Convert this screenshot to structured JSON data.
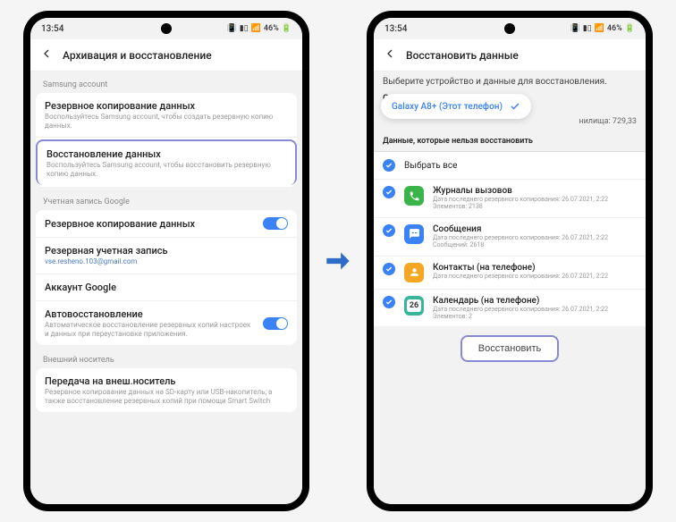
{
  "statusbar": {
    "time": "13:54",
    "battery": "46%"
  },
  "left": {
    "header_title": "Архивация и восстановление",
    "section1_label": "Samsung account",
    "backup_title": "Резервное копирование данных",
    "backup_sub": "Воспользуйтесь Samsung account, чтобы создать резервную копию данных.",
    "restore_title": "Восстановление данных",
    "restore_sub": "Воспользуйтесь Samsung account, чтобы восстановить резервную копию данных.",
    "section2_label": "Учетная запись Google",
    "g_backup_title": "Резервное копирование данных",
    "g_account_title": "Резервная учетная запись",
    "g_account_sub": "vse.resheno.103@gmail.com",
    "g_acct_title2": "Аккаунт Google",
    "autorestore_title": "Автовосстановление",
    "autorestore_sub": "Автоматическое восстановление резервных копий настроек и данных при переустановке приложения.",
    "section3_label": "Внешний носитель",
    "ext_title": "Передача на внеш.носитель",
    "ext_sub": "Резервное копирование данных на SD-карту или USB-накопитель, а также восстановление резервных копий при помощи Smart Switch"
  },
  "right": {
    "header_title": "Восстановить данные",
    "intro": "Выберите устройство и данные для восстановления.",
    "device_name": "Galaxy A8+",
    "device_date": "26.07.2021, 2:22",
    "dropdown_label": "Galaxy A8+ (Этот телефон)",
    "storage_label": "нилища: 729,33",
    "tab_label": "Данные, которые нельзя восстановить",
    "select_all": "Выбрать все",
    "items": [
      {
        "title": "Журналы вызовов",
        "sub1": "Дата последнего резервного копирования: 26.07.2021, 2:22",
        "sub2": "Элементов: 2138",
        "color": "#3bb54a",
        "icon": "phone"
      },
      {
        "title": "Сообщения",
        "sub1": "Дата последнего резервного копирования: 26.07.2021, 2:22",
        "sub2": "Сообщений: 2618",
        "color": "#3a82f7",
        "icon": "msg"
      },
      {
        "title": "Контакты (на телефоне)",
        "sub1": "Дата последнего резервного копирования: 26.07.2021, 2:22",
        "sub2": "",
        "color": "#f5a623",
        "icon": "contact"
      },
      {
        "title": "Календарь (на телефоне)",
        "sub1": "Дата последнего резервного копирования: 26.07.2021, 2:22",
        "sub2": "Элементов: 2",
        "color": "#3bb59a",
        "icon": "cal"
      }
    ],
    "restore_btn": "Восстановить"
  }
}
